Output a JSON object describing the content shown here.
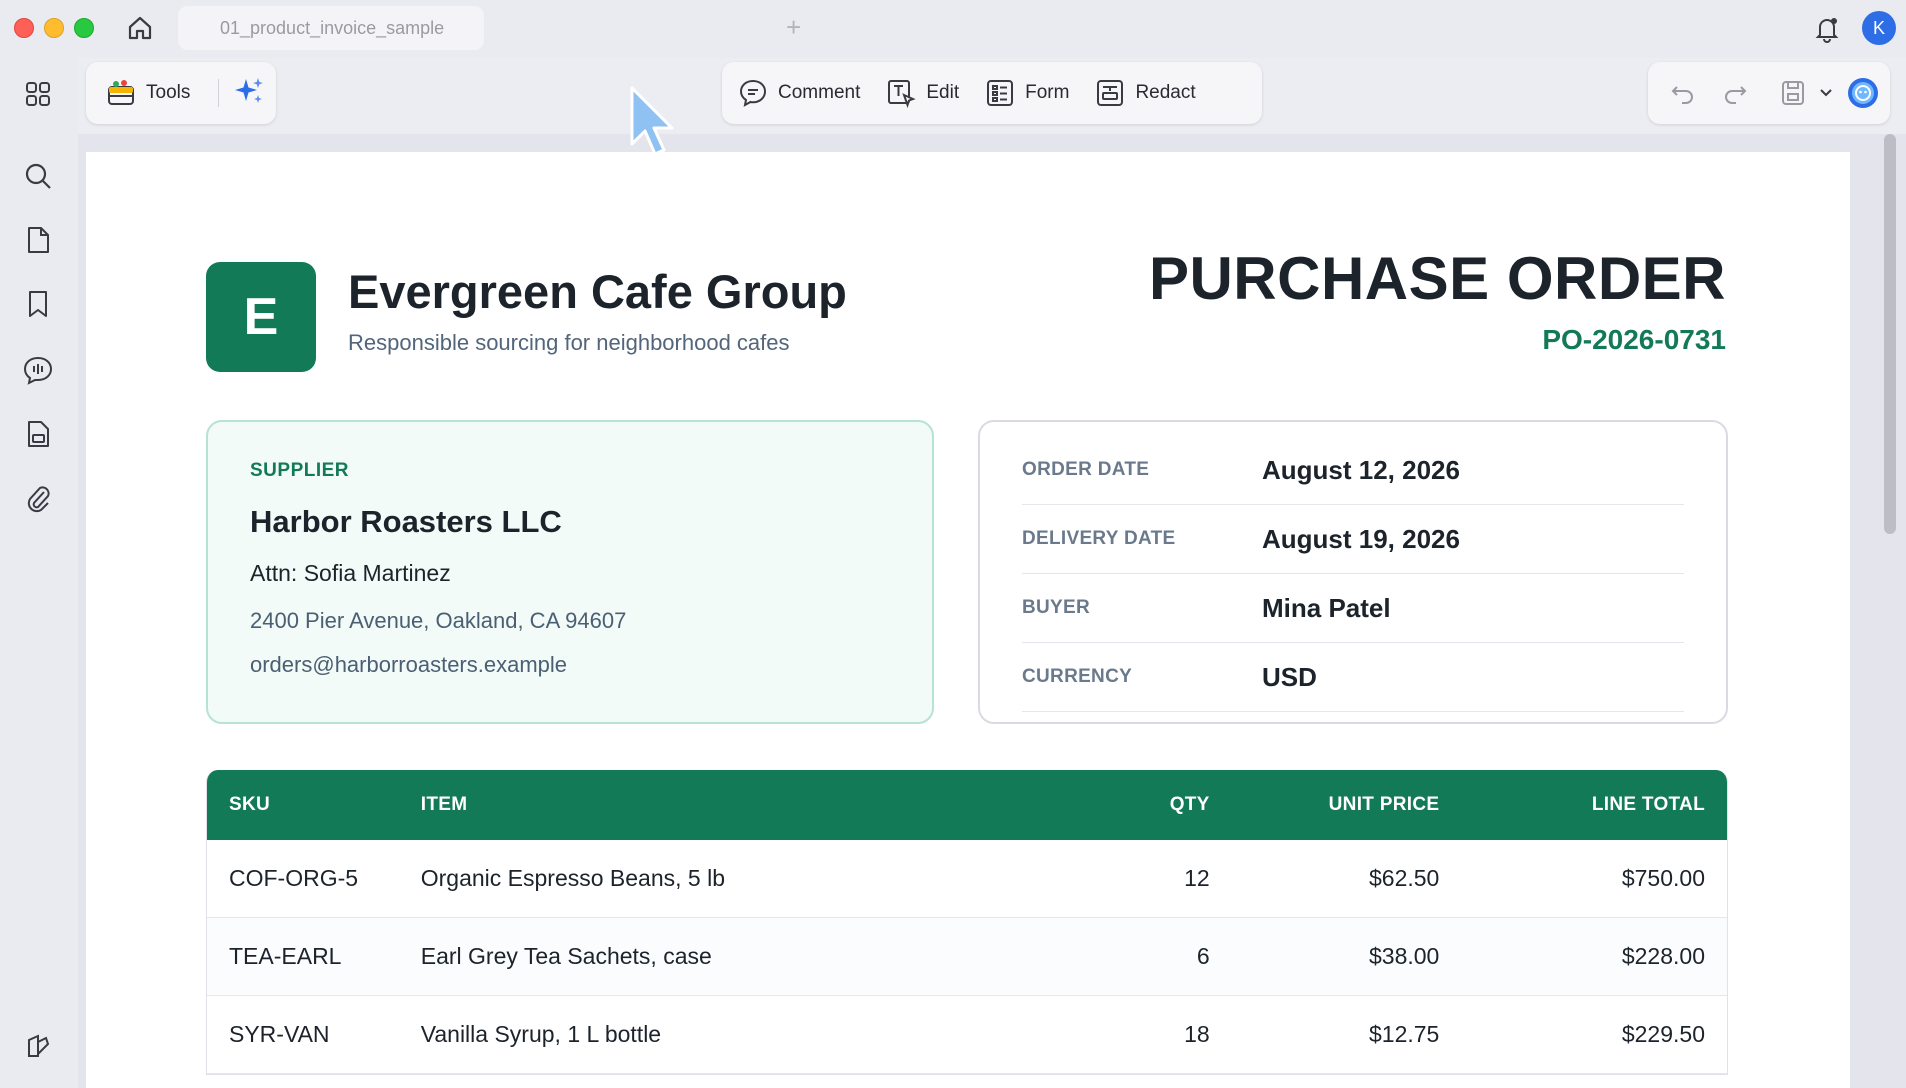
{
  "window": {
    "tab_title": "01_product_invoice_sample",
    "new_tab_symbol": "+",
    "avatar_initial": "K"
  },
  "toolbar": {
    "tools_label": "Tools",
    "comment_label": "Comment",
    "edit_label": "Edit",
    "form_label": "Form",
    "redact_label": "Redact"
  },
  "document": {
    "logo_letter": "E",
    "company_name": "Evergreen Cafe Group",
    "tagline": "Responsible sourcing for neighborhood cafes",
    "title": "PURCHASE ORDER",
    "po_number": "PO-2026-0731",
    "supplier": {
      "label": "SUPPLIER",
      "name": "Harbor Roasters LLC",
      "attn": "Attn: Sofia Martinez",
      "address": "2400 Pier Avenue, Oakland, CA 94607",
      "email": "orders@harborroasters.example"
    },
    "details": [
      {
        "label": "ORDER DATE",
        "value": "August 12, 2026"
      },
      {
        "label": "DELIVERY DATE",
        "value": "August 19, 2026"
      },
      {
        "label": "BUYER",
        "value": "Mina Patel"
      },
      {
        "label": "CURRENCY",
        "value": "USD"
      }
    ],
    "table": {
      "headers": {
        "sku": "SKU",
        "item": "ITEM",
        "qty": "QTY",
        "unit_price": "UNIT PRICE",
        "line_total": "LINE TOTAL"
      },
      "rows": [
        {
          "sku": "COF-ORG-5",
          "item": "Organic Espresso Beans, 5 lb",
          "qty": "12",
          "unit_price": "$62.50",
          "line_total": "$750.00"
        },
        {
          "sku": "TEA-EARL",
          "item": "Earl Grey Tea Sachets, case",
          "qty": "6",
          "unit_price": "$38.00",
          "line_total": "$228.00"
        },
        {
          "sku": "SYR-VAN",
          "item": "Vanilla Syrup, 1 L bottle",
          "qty": "18",
          "unit_price": "$12.75",
          "line_total": "$229.50"
        }
      ]
    }
  },
  "colors": {
    "brand_green": "#137a57",
    "accent_blue": "#2d6de6"
  },
  "icons": {
    "rail": [
      "apps-grid-icon",
      "search-icon",
      "page-icon",
      "bookmark-icon",
      "comments-icon",
      "attachment-doc-icon",
      "paperclip-icon",
      "sidebar-toggle-icon"
    ],
    "toolbar": [
      "toolbox-icon",
      "ai-sparkle-icon",
      "comment-icon",
      "edit-text-icon",
      "form-icon",
      "redact-icon",
      "undo-icon",
      "redo-icon",
      "save-icon",
      "chevron-down-icon",
      "assistant-icon"
    ]
  }
}
